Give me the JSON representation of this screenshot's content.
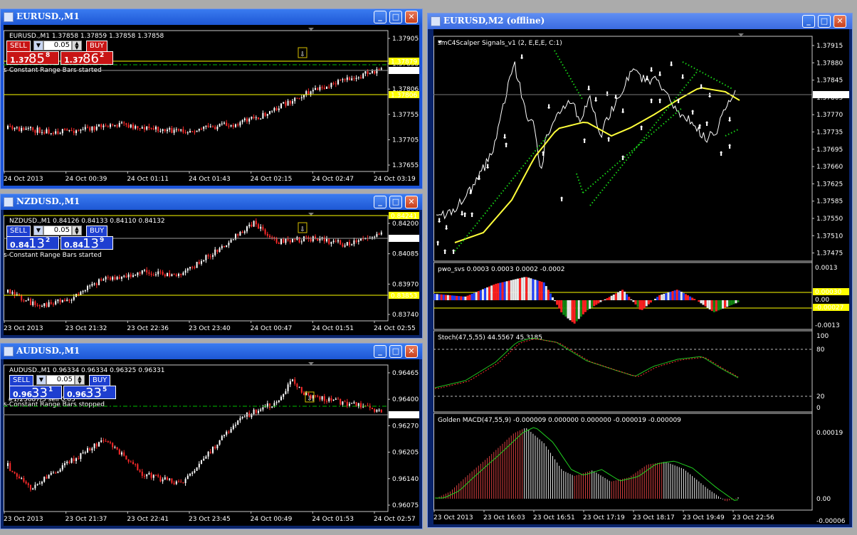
{
  "windows": [
    {
      "id": "eurusd_m1",
      "title": "EURUSD.,M1",
      "info_line": "EURUSD.,M1  1.37858 1.37859 1.37858 1.37858",
      "status_text": "s-Constant Range Bars started",
      "trade_panel": {
        "sell_label": "SELL",
        "buy_label": "BUY",
        "lot": "0.05",
        "bid_small": "1.37",
        "bid_big": "85",
        "bid_sup": "8",
        "ask_small": "1.37",
        "ask_big": "86",
        "ask_sup": "2",
        "theme": "red"
      },
      "price_labels": [
        "1.37905",
        "1.37858",
        "1.37806",
        "1.37755",
        "1.37705",
        "1.37655"
      ],
      "highlight_prices": [
        {
          "text": "1.37879",
          "kind": "yellow"
        },
        {
          "text": "1.37858",
          "kind": "white"
        },
        {
          "text": "1.37806",
          "kind": "yellow"
        }
      ],
      "time_labels": [
        "24 Oct 2013",
        "24 Oct 00:39",
        "24 Oct 01:11",
        "24 Oct 01:43",
        "24 Oct 02:15",
        "24 Oct 02:47",
        "24 Oct 03:19"
      ]
    },
    {
      "id": "nzdusd_m1",
      "title": "NZDUSD.,M1",
      "info_line": "NZDUSD.,M1  0.84126 0.84133 0.84110 0.84132",
      "status_text": "s-Constant Range Bars started",
      "trade_panel": {
        "sell_label": "SELL",
        "buy_label": "BUY",
        "lot": "0.05",
        "bid_small": "0.84",
        "bid_big": "13",
        "bid_sup": "2",
        "ask_small": "0.84",
        "ask_big": "13",
        "ask_sup": "9",
        "theme": "blue"
      },
      "price_labels": [
        "0.84200",
        "0.84085",
        "0.83970",
        "0.83740"
      ],
      "highlight_prices": [
        {
          "text": "0.84241",
          "kind": "yellow"
        },
        {
          "text": "0.84132",
          "kind": "white"
        },
        {
          "text": "0.83853",
          "kind": "yellow"
        }
      ],
      "time_labels": [
        "23 Oct 2013",
        "23 Oct 21:32",
        "23 Oct 22:36",
        "23 Oct 23:40",
        "24 Oct 00:47",
        "24 Oct 01:51",
        "24 Oct 02:55"
      ]
    },
    {
      "id": "audusd_m1",
      "title": "AUDUSD.,M1",
      "info_line": "AUDUSD.,M1  0.96334 0.96334 0.96325 0.96331",
      "status_text": "s-Constant Range Bars stopped",
      "sub_text": "#1/25687/5 sell 0.05",
      "trade_panel": {
        "sell_label": "SELL",
        "buy_label": "BUY",
        "lot": "0.05",
        "bid_small": "0.96",
        "bid_big": "33",
        "bid_sup": "1",
        "ask_small": "0.96",
        "ask_big": "33",
        "ask_sup": "5",
        "theme": "blue"
      },
      "price_labels": [
        "0.96465",
        "0.96400",
        "0.96270",
        "0.96205",
        "0.96140",
        "0.96075"
      ],
      "highlight_prices": [
        {
          "text": "0.96331",
          "kind": "white"
        }
      ],
      "time_labels": [
        "23 Oct 2013",
        "23 Oct 21:37",
        "23 Oct 22:41",
        "23 Oct 23:45",
        "24 Oct 00:49",
        "24 Oct 01:53",
        "24 Oct 02:57"
      ]
    }
  ],
  "offline": {
    "title": "EURUSD,M2 (offline)",
    "main_indicator": "smC4Scalper Signals_v1 (2, E,E,E, C:1)",
    "main_prices": [
      "1.37915",
      "1.37880",
      "1.37845",
      "1.37805",
      "1.37770",
      "1.37735",
      "1.37695",
      "1.37660",
      "1.37625",
      "1.37585",
      "1.37550",
      "1.37510",
      "1.37475"
    ],
    "main_current": "1.37858",
    "pwo_label": "pwo_svs 0.0003 0.0003 0.0002 -0.0002",
    "pwo_axis": [
      "0.0013",
      "0.00030",
      "0.00",
      "-0.00027",
      "-0.0013"
    ],
    "stoch_label": "Stoch(47,5,55) 44.5567 45.3185",
    "stoch_axis": [
      "100",
      "80",
      "20",
      "0"
    ],
    "macd_label": "Golden MACD(47,55,9) -0.000009 0.000000 0.000000 -0.000019 -0.000009",
    "macd_axis": [
      "0.00019",
      "0.00",
      "-0.00006"
    ],
    "time_labels": [
      "23 Oct 2013",
      "23 Oct 16:03",
      "23 Oct 16:51",
      "23 Oct 17:19",
      "23 Oct 18:17",
      "23 Oct 19:49",
      "23 Oct 22:56"
    ]
  },
  "title_buttons": {
    "minimize": "_",
    "maximize": "□",
    "close": "✕"
  },
  "colors": {
    "bull_candle": "#ffffff",
    "bear_candle": "#ff2a2a",
    "level_yellow": "#ffff00",
    "ask_line": "#00c000",
    "up_arrow": "#1fa8ff",
    "down_arrow": "#ff1fd2",
    "ma_yellow": "#ffff3a",
    "sar_green": "#17d317"
  }
}
